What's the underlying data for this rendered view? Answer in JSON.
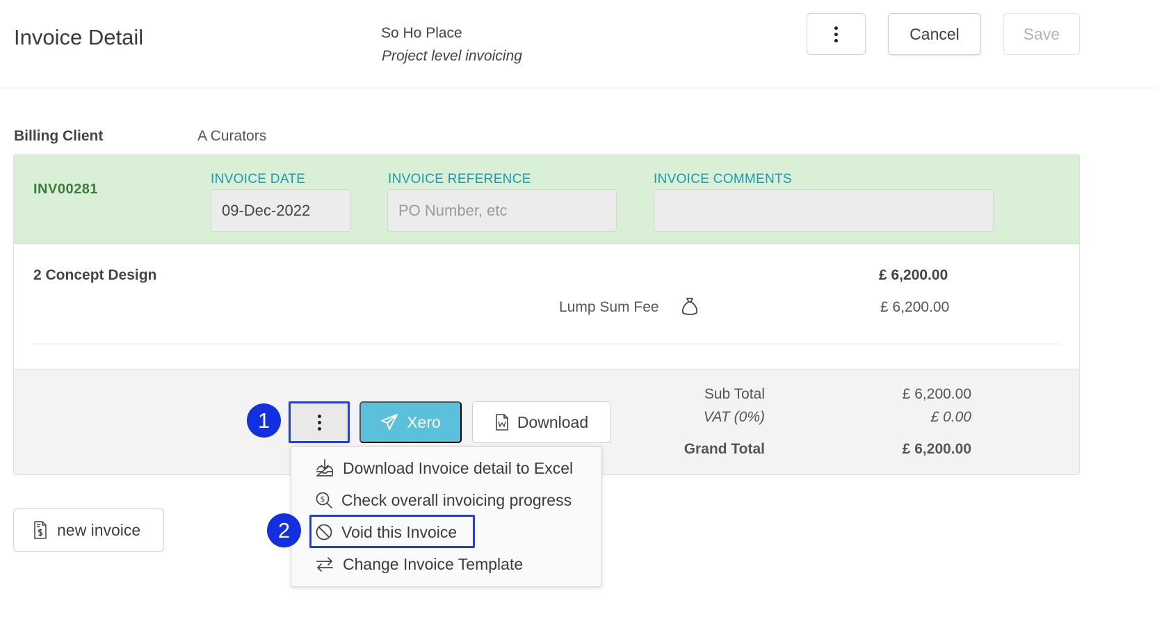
{
  "header": {
    "title": "Invoice Detail",
    "project_name": "So Ho Place",
    "project_subtitle": "Project level invoicing",
    "cancel_label": "Cancel",
    "save_label": "Save"
  },
  "billing": {
    "label": "Billing Client",
    "client": "A Curators"
  },
  "invoice": {
    "number": "INV00281",
    "date_label": "INVOICE DATE",
    "date_value": "09-Dec-2022",
    "reference_label": "INVOICE REFERENCE",
    "reference_placeholder": "PO Number, etc",
    "comments_label": "INVOICE COMMENTS",
    "comments_value": ""
  },
  "line_item": {
    "title": "2 Concept Design",
    "amount": "£ 6,200.00",
    "fee_label": "Lump Sum Fee",
    "fee_icon": "money-bag-icon",
    "fee_amount": "£ 6,200.00"
  },
  "footer": {
    "xero_label": "Xero",
    "download_label": "Download",
    "sub_total_label": "Sub Total",
    "sub_total_value": "£ 6,200.00",
    "vat_label": "VAT (0%)",
    "vat_value": "£ 0.00",
    "grand_total_label": "Grand Total",
    "grand_total_value": "£ 6,200.00"
  },
  "menu": {
    "items": [
      {
        "label": "Download Invoice detail to Excel",
        "icon": "download-tray-icon"
      },
      {
        "label": "Check overall invoicing progress",
        "icon": "search-money-icon"
      },
      {
        "label": "Void this Invoice",
        "icon": "ban-icon"
      },
      {
        "label": "Change Invoice Template",
        "icon": "swap-arrows-icon"
      }
    ]
  },
  "annotations": {
    "step1": "1",
    "step2": "2"
  },
  "new_invoice_label": "new invoice",
  "colors": {
    "green_band": "#d9f0d6",
    "invoice_number": "#3b7d3b",
    "field_label": "#1a9bb0",
    "xero_button": "#5bc0dc",
    "annotation_blue": "#1330e0"
  }
}
